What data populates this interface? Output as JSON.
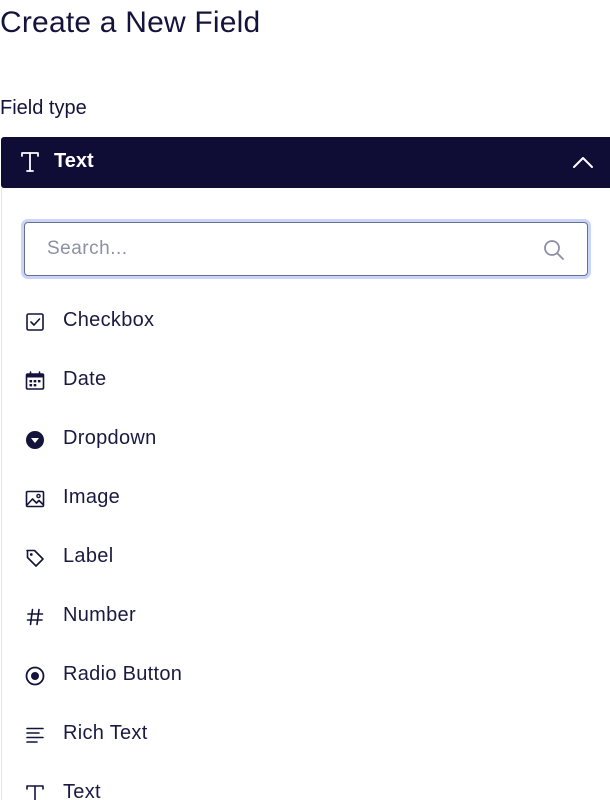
{
  "header": {
    "title": "Create a New Field"
  },
  "field_type": {
    "label": "Field type",
    "selected": "Text",
    "selected_icon": "text-type-icon",
    "expanded": true
  },
  "search": {
    "placeholder": "Search...",
    "value": ""
  },
  "options": [
    {
      "label": "Checkbox",
      "icon": "checkbox-icon"
    },
    {
      "label": "Date",
      "icon": "calendar-icon"
    },
    {
      "label": "Dropdown",
      "icon": "dropdown-circle-icon"
    },
    {
      "label": "Image",
      "icon": "image-icon"
    },
    {
      "label": "Label",
      "icon": "tag-icon"
    },
    {
      "label": "Number",
      "icon": "hash-icon"
    },
    {
      "label": "Radio Button",
      "icon": "radio-button-icon"
    },
    {
      "label": "Rich Text",
      "icon": "rich-text-icon"
    },
    {
      "label": "Text",
      "icon": "text-type-icon"
    }
  ],
  "colors": {
    "primary_dark": "#0f0c36",
    "text": "#14133b",
    "focus_ring": "#c9d4fb"
  }
}
